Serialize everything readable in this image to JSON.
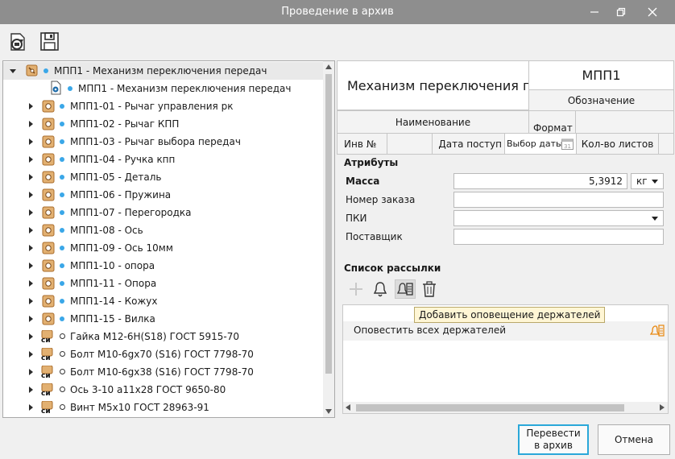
{
  "window": {
    "title": "Проведение в архив",
    "controls": [
      "minimize-icon",
      "restore-icon",
      "close-icon"
    ]
  },
  "toolbar": {
    "icons": [
      "refresh-doc-icon",
      "save-icon"
    ]
  },
  "tree": {
    "root": {
      "label": "МПП1 - Механизм переключения передач",
      "expanded": true
    },
    "assembly_doc": {
      "label": "МПП1 - Механизм переключения передач"
    },
    "items": [
      {
        "label": "МПП1-01 - Рычаг управления рк",
        "icon": "part",
        "bullet": "blue"
      },
      {
        "label": "МПП1-02 - Рычаг КПП",
        "icon": "part",
        "bullet": "blue"
      },
      {
        "label": "МПП1-03 - Рычаг выбора передач",
        "icon": "part",
        "bullet": "blue"
      },
      {
        "label": "МПП1-04 - Ручка кпп",
        "icon": "part",
        "bullet": "blue"
      },
      {
        "label": "МПП1-05 - Деталь",
        "icon": "part",
        "bullet": "blue"
      },
      {
        "label": "МПП1-06 - Пружина",
        "icon": "part",
        "bullet": "blue"
      },
      {
        "label": "МПП1-07 - Перегородка",
        "icon": "part",
        "bullet": "blue"
      },
      {
        "label": "МПП1-08 - Ось",
        "icon": "part",
        "bullet": "blue"
      },
      {
        "label": "МПП1-09 - Ось 10мм",
        "icon": "part",
        "bullet": "blue"
      },
      {
        "label": "МПП1-10 - опора",
        "icon": "part",
        "bullet": "blue"
      },
      {
        "label": "МПП1-11 - Опора",
        "icon": "part",
        "bullet": "blue"
      },
      {
        "label": "МПП1-14 - Кожух",
        "icon": "part",
        "bullet": "blue"
      },
      {
        "label": "МПП1-15 - Вилка",
        "icon": "part",
        "bullet": "blue"
      },
      {
        "label": "Гайка М12-6H(S18) ГОСТ 5915-70",
        "icon": "standard",
        "bullet": "hollow"
      },
      {
        "label": "Болт М10-6gх70 (S16) ГОСТ 7798-70",
        "icon": "standard",
        "bullet": "hollow"
      },
      {
        "label": "Болт М10-6gх38 (S16) ГОСТ 7798-70",
        "icon": "standard",
        "bullet": "hollow"
      },
      {
        "label": "Ось 3-10 а11х28 ГОСТ 9650-80",
        "icon": "standard",
        "bullet": "hollow"
      },
      {
        "label": "Винт М5х10 ГОСТ 28963-91",
        "icon": "standard",
        "bullet": "hollow"
      }
    ],
    "standard_icon_text": "си"
  },
  "stamp": {
    "name_value": "Механизм переключения п",
    "designation_value": "МПП1",
    "designation_label": "Обозначение",
    "name_label": "Наименование",
    "format_label": "Формат",
    "inv_label": "Инв №",
    "date_label": "Дата поступ",
    "date_placeholder": "Выбор даты",
    "sheets_label": "Кол-во листов",
    "calendar_day": "31"
  },
  "attributes": {
    "heading": "Атрибуты",
    "mass_label": "Масса",
    "mass_value": "5,3912",
    "mass_unit": "кг",
    "order_label": "Номер заказа",
    "order_value": "",
    "pki_label": "ПКИ",
    "pki_value": "",
    "supplier_label": "Поставщик",
    "supplier_value": ""
  },
  "mailing": {
    "heading": "Список рассылки",
    "toolbar_icons": [
      "add-icon",
      "bell-icon",
      "holders-notify-icon",
      "trash-icon"
    ],
    "tooltip": "Добавить оповещение держателей",
    "row_label": "Оповестить всех держателей"
  },
  "buttons": {
    "archive_label": "Перевести в архив",
    "cancel_label": "Отмена"
  },
  "colors": {
    "titlebar": "#8e8e8e",
    "bullet_blue": "#3aa7e8",
    "primary_border": "#2aa8d9",
    "part_icon": "#c98a3c"
  }
}
